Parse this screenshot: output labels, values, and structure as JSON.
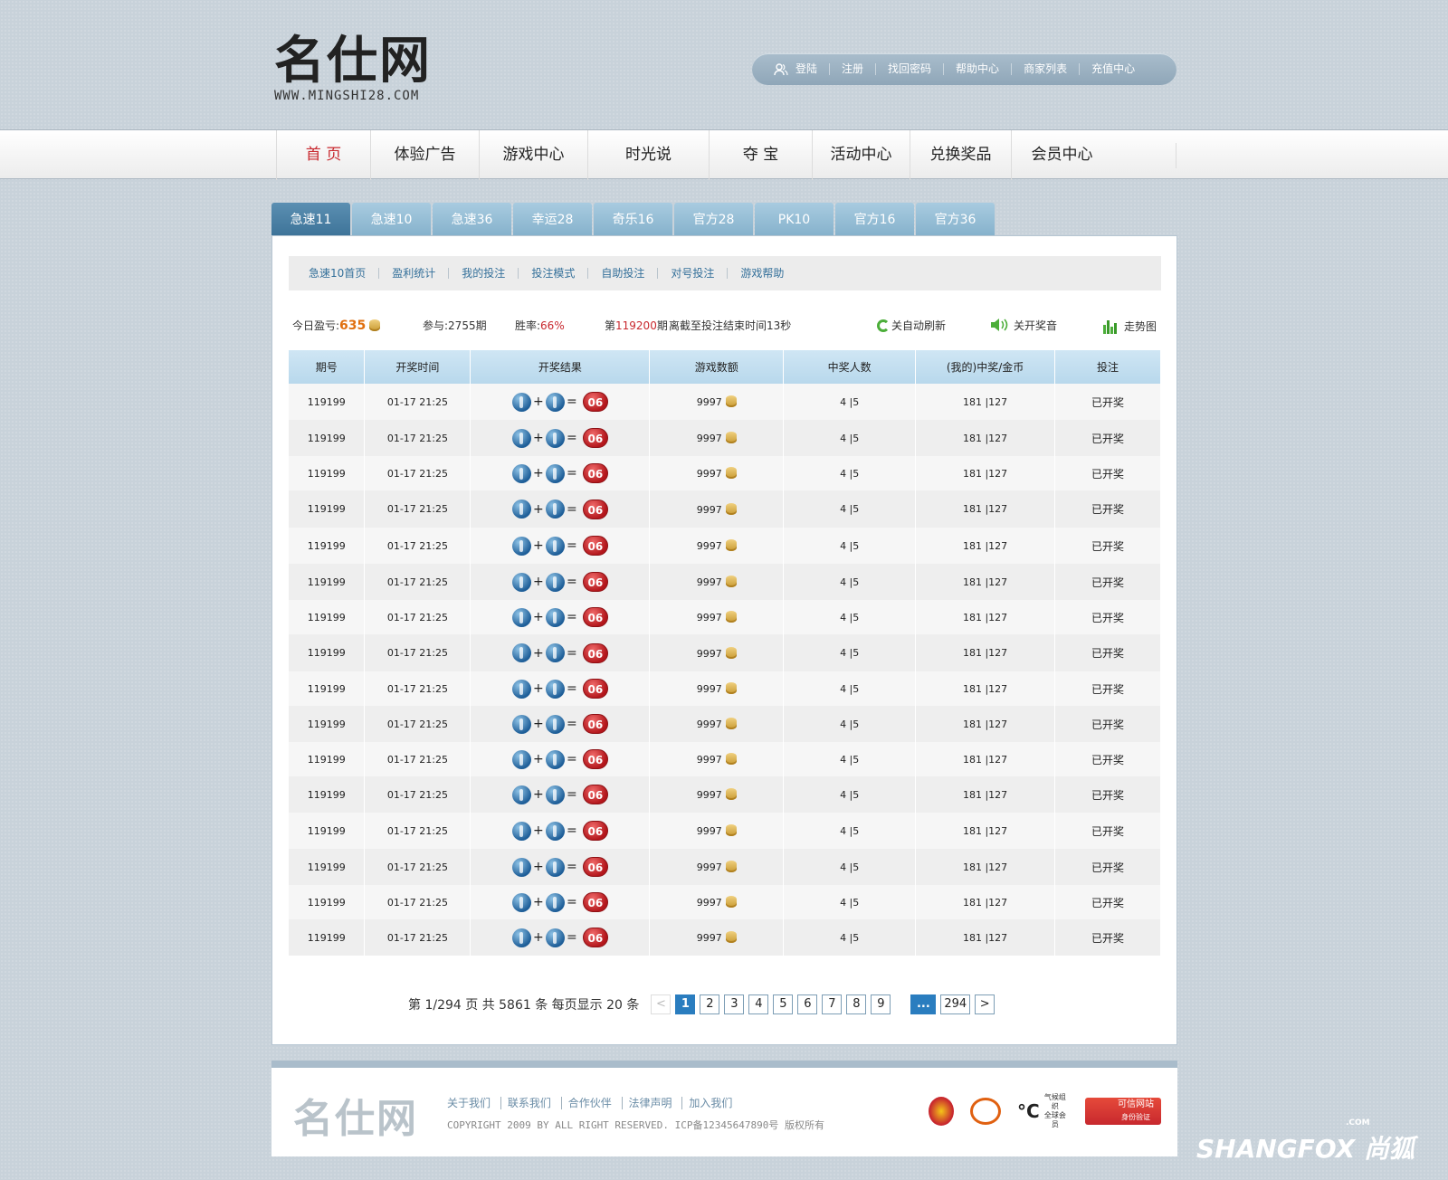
{
  "logo": {
    "cn": "名仕网",
    "en": "WWW.MINGSHI28.COM"
  },
  "toplinks": [
    "登陆",
    "注册",
    "找回密码",
    "帮助中心",
    "商家列表",
    "充值中心"
  ],
  "nav": [
    "首 页",
    "体验广告",
    "游戏中心",
    "时光说",
    "夺 宝",
    "活动中心",
    "兑换奖品",
    "会员中心"
  ],
  "tabs": [
    "急速11",
    "急速10",
    "急速36",
    "幸运28",
    "奇乐16",
    "官方28",
    "PK10",
    "官方16",
    "官方36"
  ],
  "subnav": [
    "急速10首页",
    "盈利统计",
    "我的投注",
    "投注模式",
    "自助投注",
    "对号投注",
    "游戏帮助"
  ],
  "stats": {
    "today_label": "今日盈亏:",
    "today_value": "635",
    "participate_label": "参与:",
    "participate_value": "2755期",
    "winrate_label": "胜率:",
    "winrate_value": "66%",
    "period_prefix": "第",
    "period_value": "119200",
    "period_suffix": "期",
    "countdown": "离截至投注结束时间13秒",
    "auto_refresh": "关自动刷新",
    "sound": "关开奖音",
    "trend": "走势图"
  },
  "table": {
    "headers": [
      "期号",
      "开奖时间",
      "开奖结果",
      "游戏数额",
      "中奖人数",
      "(我的)中奖/金币",
      "投注"
    ],
    "rows": [
      {
        "id": "119199",
        "time": "01-17 21:25",
        "plus": "+",
        "eq": "=",
        "result": "06",
        "amount": "9997",
        "winners": "4 |5",
        "mine": "181 |127",
        "status": "已开奖"
      },
      {
        "id": "119199",
        "time": "01-17 21:25",
        "plus": "+",
        "eq": "=",
        "result": "06",
        "amount": "9997",
        "winners": "4 |5",
        "mine": "181 |127",
        "status": "已开奖"
      },
      {
        "id": "119199",
        "time": "01-17 21:25",
        "plus": "+",
        "eq": "=",
        "result": "06",
        "amount": "9997",
        "winners": "4 |5",
        "mine": "181 |127",
        "status": "已开奖"
      },
      {
        "id": "119199",
        "time": "01-17 21:25",
        "plus": "+",
        "eq": "=",
        "result": "06",
        "amount": "9997",
        "winners": "4 |5",
        "mine": "181 |127",
        "status": "已开奖"
      },
      {
        "id": "119199",
        "time": "01-17 21:25",
        "plus": "+",
        "eq": "=",
        "result": "06",
        "amount": "9997",
        "winners": "4 |5",
        "mine": "181 |127",
        "status": "已开奖"
      },
      {
        "id": "119199",
        "time": "01-17 21:25",
        "plus": "+",
        "eq": "=",
        "result": "06",
        "amount": "9997",
        "winners": "4 |5",
        "mine": "181 |127",
        "status": "已开奖"
      },
      {
        "id": "119199",
        "time": "01-17 21:25",
        "plus": "+",
        "eq": "=",
        "result": "06",
        "amount": "9997",
        "winners": "4 |5",
        "mine": "181 |127",
        "status": "已开奖"
      },
      {
        "id": "119199",
        "time": "01-17 21:25",
        "plus": "+",
        "eq": "=",
        "result": "06",
        "amount": "9997",
        "winners": "4 |5",
        "mine": "181 |127",
        "status": "已开奖"
      },
      {
        "id": "119199",
        "time": "01-17 21:25",
        "plus": "+",
        "eq": "=",
        "result": "06",
        "amount": "9997",
        "winners": "4 |5",
        "mine": "181 |127",
        "status": "已开奖"
      },
      {
        "id": "119199",
        "time": "01-17 21:25",
        "plus": "+",
        "eq": "=",
        "result": "06",
        "amount": "9997",
        "winners": "4 |5",
        "mine": "181 |127",
        "status": "已开奖"
      },
      {
        "id": "119199",
        "time": "01-17 21:25",
        "plus": "+",
        "eq": "=",
        "result": "06",
        "amount": "9997",
        "winners": "4 |5",
        "mine": "181 |127",
        "status": "已开奖"
      },
      {
        "id": "119199",
        "time": "01-17 21:25",
        "plus": "+",
        "eq": "=",
        "result": "06",
        "amount": "9997",
        "winners": "4 |5",
        "mine": "181 |127",
        "status": "已开奖"
      },
      {
        "id": "119199",
        "time": "01-17 21:25",
        "plus": "+",
        "eq": "=",
        "result": "06",
        "amount": "9997",
        "winners": "4 |5",
        "mine": "181 |127",
        "status": "已开奖"
      },
      {
        "id": "119199",
        "time": "01-17 21:25",
        "plus": "+",
        "eq": "=",
        "result": "06",
        "amount": "9997",
        "winners": "4 |5",
        "mine": "181 |127",
        "status": "已开奖"
      },
      {
        "id": "119199",
        "time": "01-17 21:25",
        "plus": "+",
        "eq": "=",
        "result": "06",
        "amount": "9997",
        "winners": "4 |5",
        "mine": "181 |127",
        "status": "已开奖"
      },
      {
        "id": "119199",
        "time": "01-17 21:25",
        "plus": "+",
        "eq": "=",
        "result": "06",
        "amount": "9997",
        "winners": "4 |5",
        "mine": "181 |127",
        "status": "已开奖"
      }
    ]
  },
  "pager": {
    "info": "第 1/294 页 共 5861 条 每页显示 20 条",
    "prev": "<",
    "pages": [
      "1",
      "2",
      "3",
      "4",
      "5",
      "6",
      "7",
      "8",
      "9"
    ],
    "ellipsis": "...",
    "last": "294",
    "next": ">"
  },
  "footer": {
    "logo": "名仕网",
    "links": [
      "关于我们",
      "联系我们",
      "合作伙伴",
      "法律声明",
      "加入我们"
    ],
    "copyright": "COPYRIGHT 2009 BY ALL RIGHT RESERVED. ICP备12345647890号 版权所有",
    "badge_c_text": "°C",
    "badge_c_caption_1": "气候组织",
    "badge_c_caption_2": "全球会员",
    "badge_trust_1": "可信网站",
    "badge_trust_2": "身份验证"
  },
  "watermark": {
    "text": "SHANGFOX 尚狐",
    "com": ".COM"
  },
  "colors": {
    "accent_red": "#c8282e",
    "tab_blue": "#86b2cc",
    "tab_active": "#3e7499",
    "header_pill": "#8fa6b8",
    "pager_blue": "#2a7dbf"
  }
}
